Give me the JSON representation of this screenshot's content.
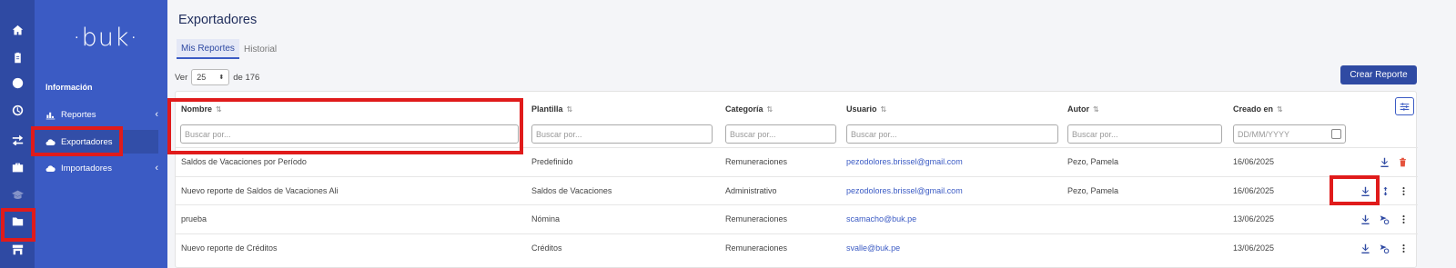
{
  "app": {
    "logo_text": "·buk·",
    "brand_color": "#3b5bc4",
    "highlight_color": "#e01b1b"
  },
  "rail": {
    "icons": [
      "home-icon",
      "clipboard-icon",
      "coin-icon",
      "clock-icon",
      "transfer-icon",
      "briefcase-icon",
      "graduation-icon",
      "folder-icon",
      "store-icon"
    ]
  },
  "menu": {
    "heading": "Información",
    "items": [
      {
        "label": "Reportes",
        "icon": "bar-chart-icon",
        "expandable": true
      },
      {
        "label": "Exportadores",
        "icon": "cloud-icon",
        "active": true
      },
      {
        "label": "Importadores",
        "icon": "cloud-icon",
        "expandable": true
      }
    ],
    "chevron": "‹"
  },
  "page": {
    "title": "Exportadores",
    "tabs": [
      {
        "label": "Mis Reportes",
        "active": true
      },
      {
        "label": "Historial",
        "active": false
      }
    ],
    "pagination": {
      "prefix": "Ver",
      "per_page": "25",
      "suffix": "de 176"
    },
    "create_button": "Crear Reporte"
  },
  "table": {
    "sort_glyph": "⇅",
    "columns": [
      {
        "label": "Nombre",
        "filter_placeholder": "Buscar por..."
      },
      {
        "label": "Plantilla",
        "filter_placeholder": "Buscar por..."
      },
      {
        "label": "Categoría",
        "filter_placeholder": "Buscar por..."
      },
      {
        "label": "Usuario",
        "filter_placeholder": "Buscar por..."
      },
      {
        "label": "Autor",
        "filter_placeholder": "Buscar por..."
      },
      {
        "label": "Creado en",
        "filter_placeholder": "DD/MM/YYYY"
      }
    ],
    "rows": [
      {
        "nombre": "Saldos de Vacaciones por Período",
        "plantilla": "Predefinido",
        "categoria": "Remuneraciones",
        "usuario": "pezodolores.brissel@gmail.com",
        "autor": "Pezo, Pamela",
        "creado": "16/06/2025",
        "actions": [
          "download-icon",
          "trash-icon"
        ]
      },
      {
        "nombre": "Nuevo reporte de Saldos de Vacaciones Ali",
        "plantilla": "Saldos de Vacaciones",
        "categoria": "Administrativo",
        "usuario": "pezodolores.brissel@gmail.com",
        "autor": "Pezo, Pamela",
        "creado": "16/06/2025",
        "actions": [
          "download-icon",
          "share-icon",
          "more-vertical-icon"
        ]
      },
      {
        "nombre": "prueba",
        "plantilla": "Nómina",
        "categoria": "Remuneraciones",
        "usuario": "scamacho@buk.pe",
        "autor": "",
        "creado": "13/06/2025",
        "actions": [
          "download-icon",
          "schedule-send-icon",
          "more-vertical-icon"
        ]
      },
      {
        "nombre": "Nuevo reporte de Créditos",
        "plantilla": "Créditos",
        "categoria": "Remuneraciones",
        "usuario": "svalle@buk.pe",
        "autor": "",
        "creado": "13/06/2025",
        "actions": [
          "download-icon",
          "schedule-send-icon",
          "more-vertical-icon"
        ]
      }
    ]
  }
}
